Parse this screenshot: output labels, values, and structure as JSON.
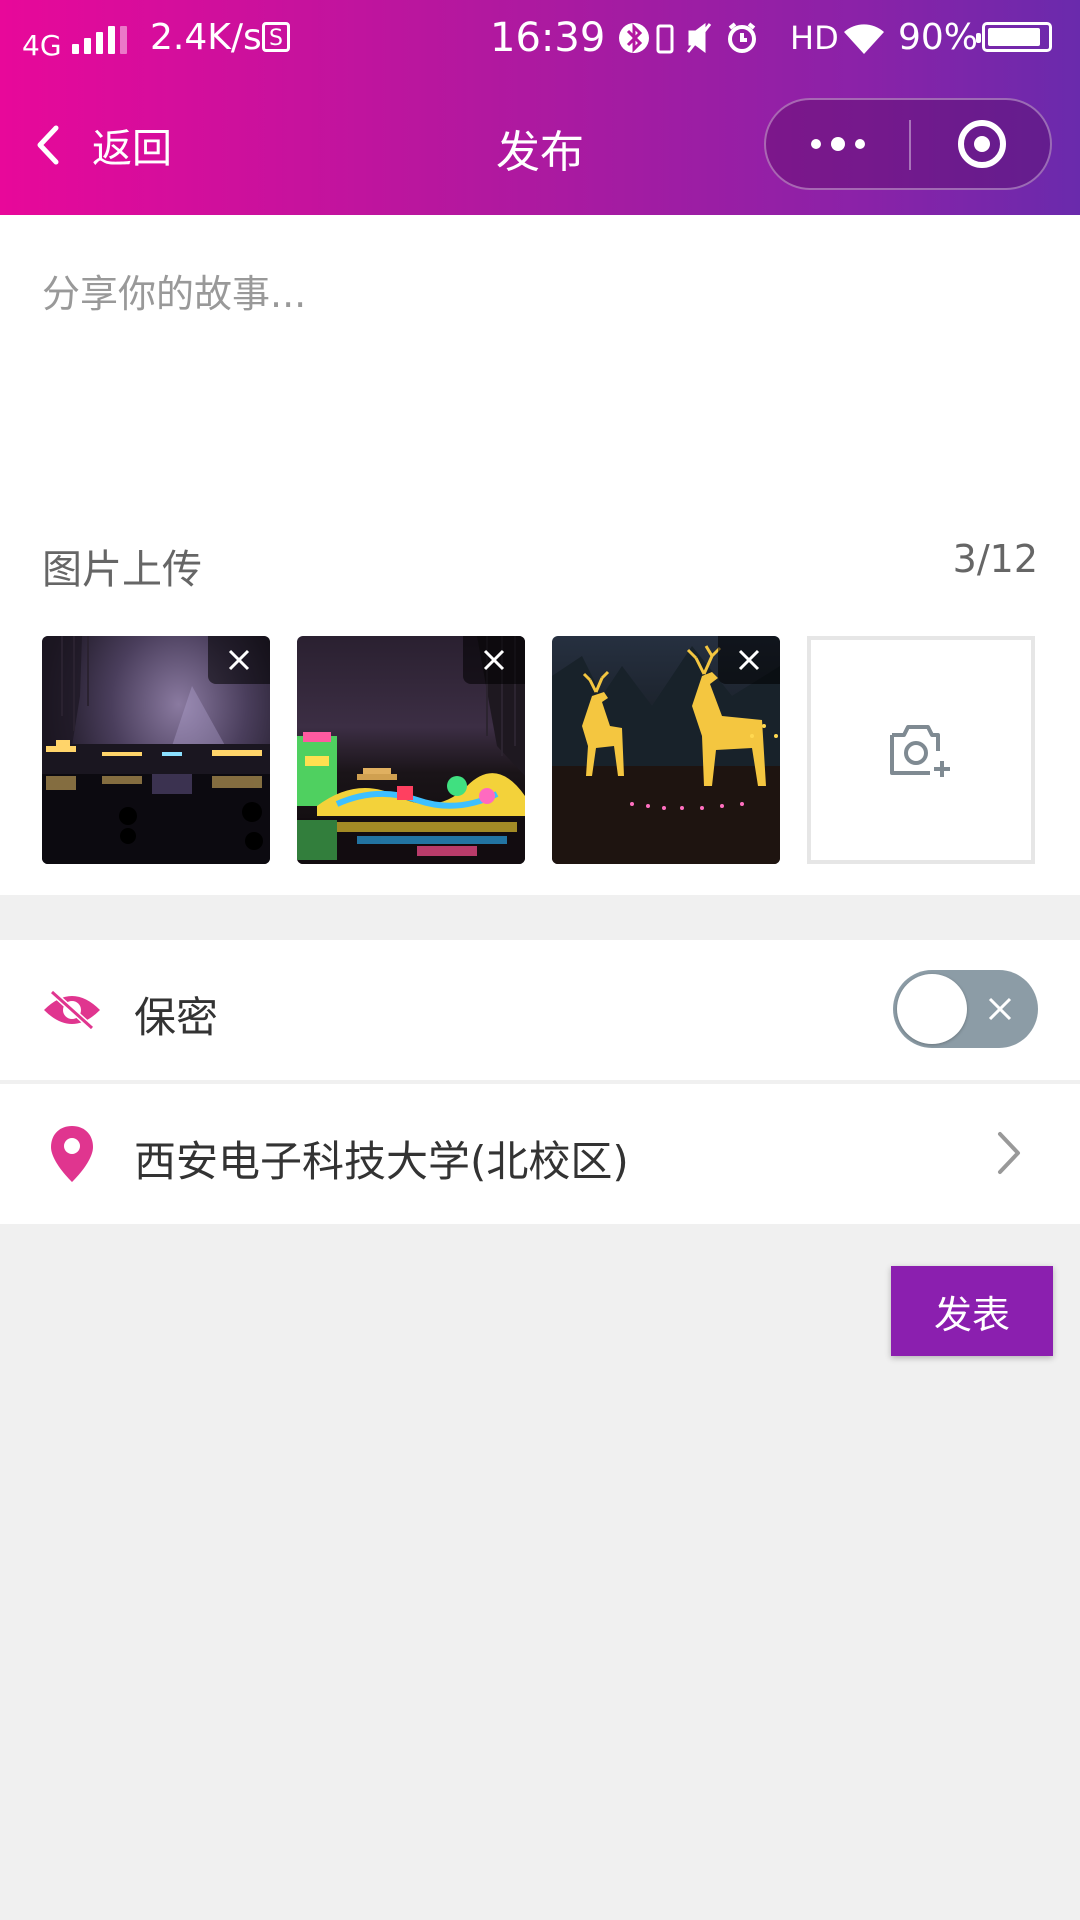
{
  "status_bar": {
    "network": "4G",
    "speed": "2.4K/s",
    "time": "16:39",
    "hd": "HD",
    "battery_percent": "90%",
    "battery_level": 0.9
  },
  "nav": {
    "back_label": "返回",
    "title": "发布"
  },
  "editor": {
    "placeholder": "分享你的故事..."
  },
  "upload": {
    "label": "图片上传",
    "count": "3/12",
    "images": [
      "lantern-lake-photo",
      "lantern-dragon-photo",
      "lantern-deer-photo"
    ]
  },
  "privacy": {
    "label": "保密",
    "enabled": false
  },
  "location": {
    "label": "西安电子科技大学(北校区)"
  },
  "actions": {
    "publish_label": "发表"
  },
  "colors": {
    "header_start": "#e8089a",
    "header_end": "#6a2aac",
    "accent": "#8b1faf",
    "icon_pink": "#e0358f",
    "toggle_off": "#8c9ca6"
  }
}
